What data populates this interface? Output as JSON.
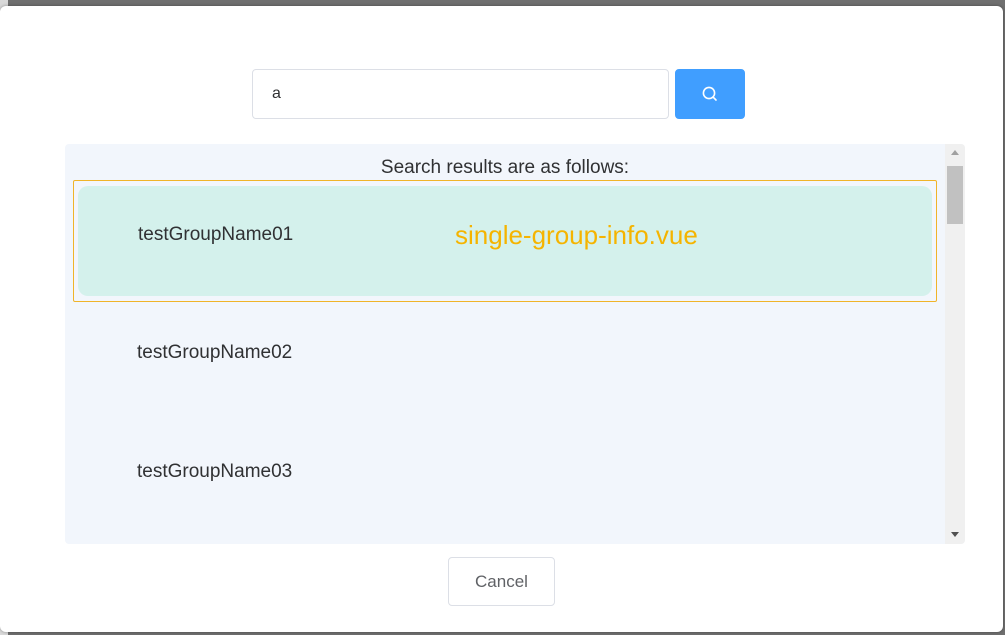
{
  "search": {
    "value": "a",
    "button_icon": "search-icon",
    "button_color": "#409eff"
  },
  "results": {
    "heading": "Search results are as follows:",
    "items": [
      {
        "label": "testGroupName01",
        "highlighted": true
      },
      {
        "label": "testGroupName02",
        "highlighted": false
      },
      {
        "label": "testGroupName03",
        "highlighted": false
      }
    ],
    "annotation": "single-group-info.vue",
    "annotation_color": "#f5b400",
    "highlight_color": "#d4f1ec",
    "highlight_border_color": "#f0b429"
  },
  "footer": {
    "cancel_label": "Cancel"
  }
}
